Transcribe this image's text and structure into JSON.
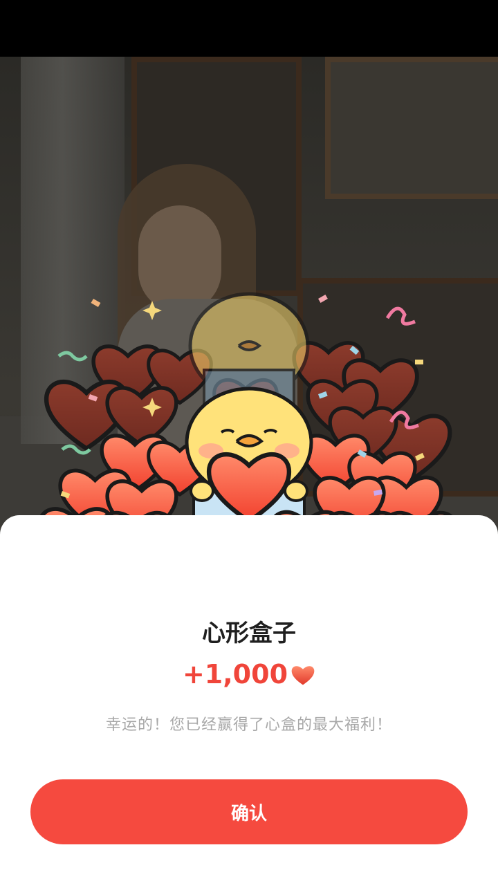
{
  "dialog": {
    "title": "心形盒子",
    "reward_amount": "+1,000",
    "reward_icon": "heart-icon",
    "message": "幸运的！您已经赢得了心盒的最大福利！",
    "confirm_label": "确认"
  },
  "colors": {
    "accent": "#f54a3f",
    "reward_text": "#f0453a",
    "message_text": "#a8a8a8",
    "title_text": "#1f1f1f"
  }
}
